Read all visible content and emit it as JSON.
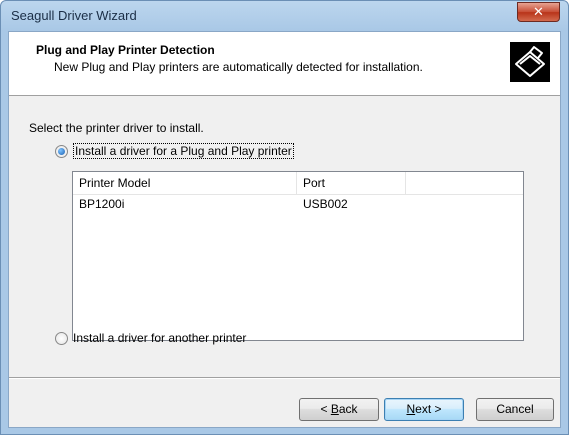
{
  "window": {
    "title": "Seagull Driver Wizard",
    "close_glyph": "✕"
  },
  "header": {
    "title": "Plug and Play Printer Detection",
    "subtitle": "New Plug and Play printers are automatically detected for installation.",
    "icon": "printer-wizard-icon"
  },
  "body": {
    "instruction": "Select the printer driver to install.",
    "options": [
      {
        "label": "Install a driver for a Plug and Play printer",
        "selected": true
      },
      {
        "label": "Install a driver for another printer",
        "selected": false
      }
    ],
    "table": {
      "columns": [
        "Printer Model",
        "Port",
        ""
      ],
      "rows": [
        {
          "model": "BP1200i",
          "port": "USB002"
        }
      ]
    }
  },
  "buttons": {
    "back": {
      "pre": "< ",
      "accel": "B",
      "post": "ack"
    },
    "next": {
      "accel": "N",
      "post": "ext >"
    },
    "cancel": "Cancel"
  },
  "colors": {
    "titlebar": "#bcd6ee",
    "close": "#c74d35",
    "dialog_bg": "#f0f0f0",
    "header_bg": "#ffffff"
  }
}
